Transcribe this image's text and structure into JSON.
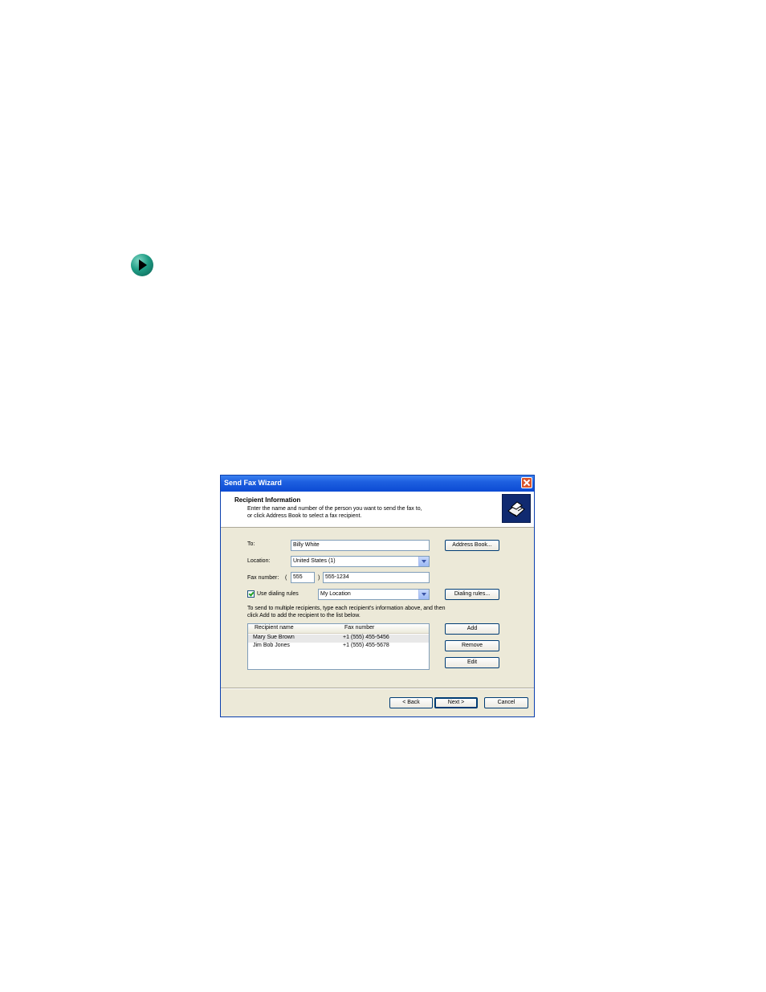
{
  "window": {
    "title": "Send Fax Wizard",
    "close_icon": "close-icon"
  },
  "header": {
    "title": "Recipient Information",
    "desc_line1": "Enter the name and number of the person you want to send the fax to,",
    "desc_line2": "or click Address Book to select a fax recipient.",
    "icon": "fax-machine-icon"
  },
  "form": {
    "to_label": "To:",
    "to_value": "Billy White",
    "address_book_label": "Address Book...",
    "location_label": "Location:",
    "location_value": "United States (1)",
    "fax_number_label": "Fax number:",
    "open_paren": "(",
    "close_paren": ")",
    "area_code": "555",
    "fax_number": "555-1234",
    "use_dialing_rules_label": "Use dialing rules",
    "dialing_location": "My Location",
    "dialing_rules_label": "Dialing rules...",
    "multi_line1": "To send to multiple recipients, type each recipient's information above, and then",
    "multi_line2": "click Add to add the recipient to the list below."
  },
  "list": {
    "columns": [
      "Recipient name",
      "Fax number"
    ],
    "rows": [
      {
        "name": "Mary Sue Brown",
        "fax": "+1 (555) 455-5456"
      },
      {
        "name": "Jim Bob Jones",
        "fax": "+1 (555) 455-5678"
      }
    ]
  },
  "list_buttons": {
    "add": "Add",
    "remove": "Remove",
    "edit": "Edit"
  },
  "nav_buttons": {
    "back": "< Back",
    "next": "Next >",
    "cancel": "Cancel"
  },
  "colors": {
    "titlebar": "#0c4bd4",
    "dialog_bg": "#ece9d8",
    "bullet": "#1f9c84"
  }
}
